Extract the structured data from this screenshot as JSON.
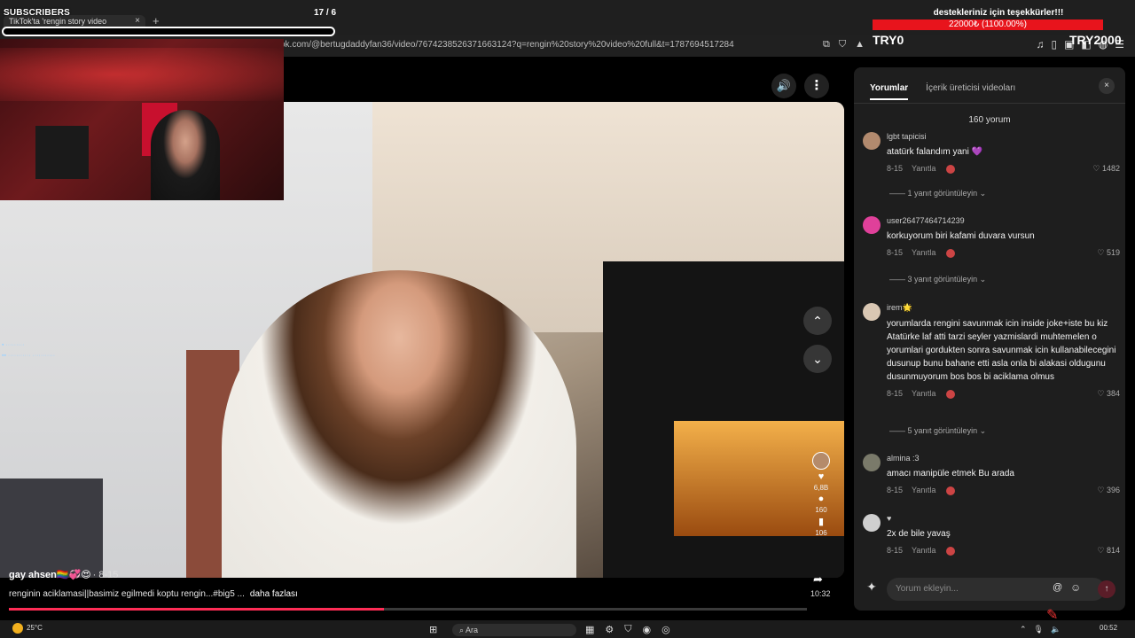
{
  "overlay": {
    "subscribers_label": "SUBSCRIBERS",
    "subscribers_count": "17 / 6",
    "donation_title": "destekleriniz için teşekkürler!!!",
    "donation_progress": "22000₺ (1100.00%)",
    "try_left": "TRY0",
    "try_right": "TRY2000"
  },
  "browser": {
    "tab_title": "TikTok'ta 'rengin story video",
    "tab_close": "×",
    "new_tab": "+",
    "url": "ok.com/@bertugdaddyfan36/video/7674238526371663124?q=rengin%20story%20video%20full&t=1787694517284"
  },
  "video": {
    "sound_icon": "🔊",
    "more_icon": "⋮",
    "up_icon": "⌃",
    "down_icon": "⌄",
    "author": "gay ahsen🏳️‍🌈💞😍",
    "date": "· 8-15",
    "caption": "renginin aciklamasi||basimiz egilmedi koptu rengin...#big5 ...",
    "more_label": "daha fazlası",
    "like_count": "6,8B",
    "comment_count": "160",
    "save_count": "106",
    "duration": "10:32",
    "progress_fraction": 0.47
  },
  "comments_panel": {
    "tab_comments": "Yorumlar",
    "tab_creator_videos": "İçerik üreticisi videoları",
    "close_icon": "×",
    "count": "160 yorum",
    "input_placeholder": "Yorum ekleyin...",
    "at_icon": "@",
    "emoji_icon": "☺",
    "send_icon": "↑",
    "comments": [
      {
        "user": "lgbt tapicisi",
        "text": "atatürk falandım yani 💜",
        "date": "8-15",
        "reply": "Yanıtla",
        "likes": "1482",
        "replies": "1 yanıt görüntüleyin ⌄",
        "avatar_color": "#b28a6e"
      },
      {
        "user": "user26477464714239",
        "text": "korkuyorum biri kafami duvara vursun",
        "date": "8-15",
        "reply": "Yanıtla",
        "likes": "519",
        "replies": "3 yanıt görüntüleyin ⌄",
        "avatar_color": "#e0409a"
      },
      {
        "user": "irem🌟",
        "text": "yorumlarda rengini savunmak icin inside joke+iste bu kiz Atatürke laf atti tarzi seyler yazmislardi muhtemelen o yorumlari gordukten sonra savunmak icin kullanabilecegini dusunup bunu bahane etti asla onla bi alakasi oldugunu dusunmuyorum bos bos bi aciklama olmus",
        "date": "8-15",
        "reply": "Yanıtla",
        "likes": "384",
        "replies": "5 yanıt görüntüleyin ⌄",
        "avatar_color": "#d9c7b3"
      },
      {
        "user": "almina :3",
        "text": "amacı manipüle etmek Bu arada",
        "date": "8-15",
        "reply": "Yanıtla",
        "likes": "396",
        "replies": "",
        "avatar_color": "#7a7a6a"
      },
      {
        "user": "♥",
        "text": "2x de bile yavaş",
        "date": "8-15",
        "reply": "Yanıtla",
        "likes": "814",
        "replies": "",
        "avatar_color": "#cfcfcf"
      }
    ]
  },
  "taskbar": {
    "temperature": "25°C",
    "search_label": "Ara",
    "time": "00:52"
  }
}
